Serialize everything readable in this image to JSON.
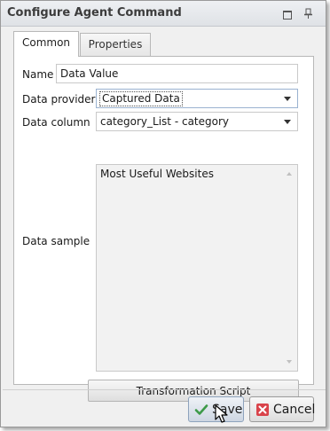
{
  "window": {
    "title": "Configure Agent Command"
  },
  "tabs": [
    {
      "label": "Common",
      "active": true
    },
    {
      "label": "Properties",
      "active": false
    }
  ],
  "form": {
    "name": {
      "label": "Name",
      "value": "Data Value"
    },
    "data_provider": {
      "label": "Data provider",
      "value": "Captured Data"
    },
    "data_column": {
      "label": "Data column",
      "value": "category_List - category"
    },
    "data_sample": {
      "label": "Data sample",
      "value": "Most Useful Websites"
    }
  },
  "buttons": {
    "transformation_script": "Transformation Script",
    "save": "Save",
    "cancel": "Cancel"
  },
  "icons": {
    "restore": "restore-icon",
    "pin": "pin-icon",
    "save": "checkmark-icon",
    "cancel": "close-icon",
    "cursor": "mouse-pointer-icon"
  },
  "colors": {
    "save_check": "#3c9a48",
    "cancel_x": "#d9434a"
  }
}
